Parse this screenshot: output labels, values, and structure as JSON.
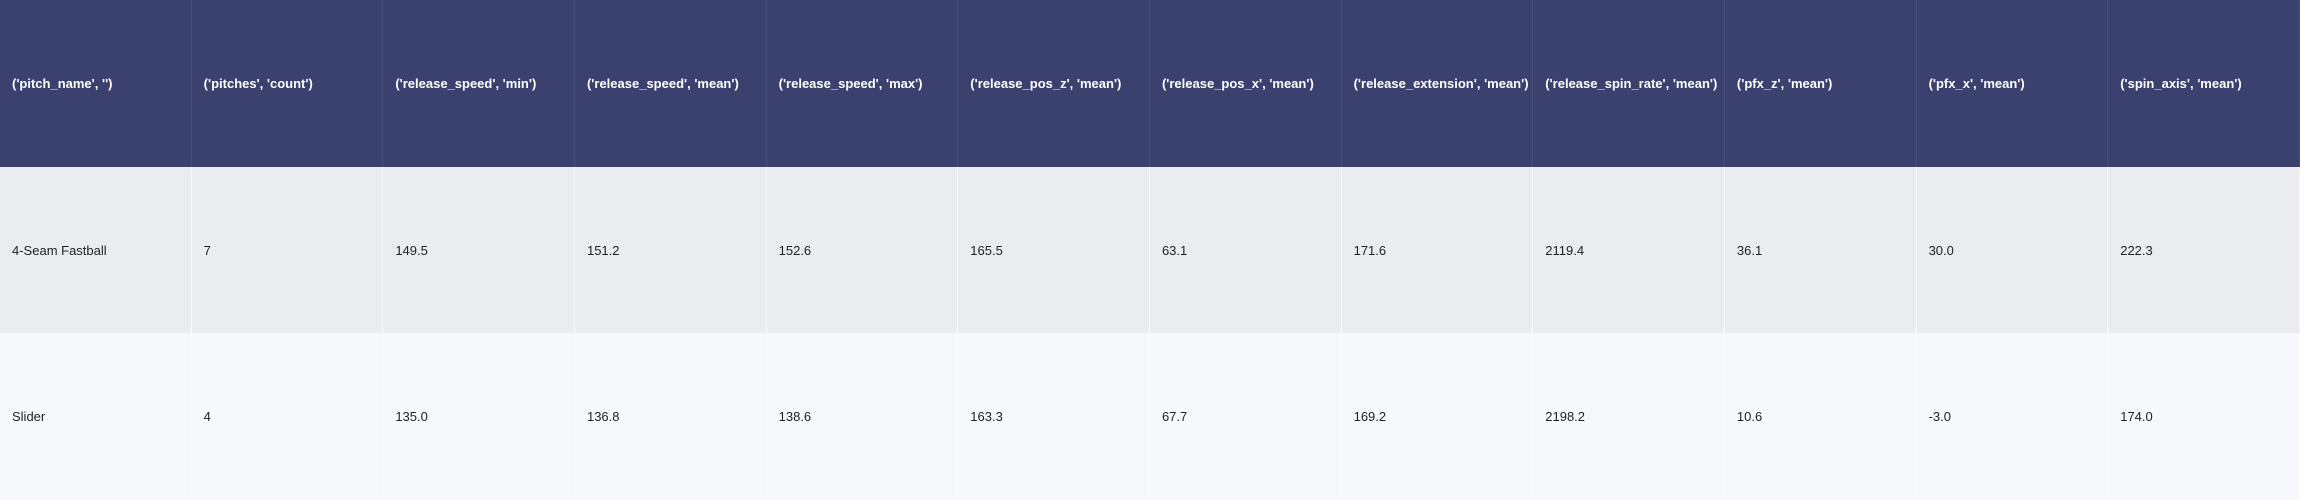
{
  "chart_data": {
    "type": "table",
    "columns": [
      "('pitch_name', '')",
      "('pitches', 'count')",
      "('release_speed', 'min')",
      "('release_speed', 'mean')",
      "('release_speed', 'max')",
      "('release_pos_z', 'mean')",
      "('release_pos_x', 'mean')",
      "('release_extension', 'mean')",
      "('release_spin_rate', 'mean')",
      "('pfx_z', 'mean')",
      "('pfx_x', 'mean')",
      "('spin_axis', 'mean')"
    ],
    "rows": [
      [
        "4-Seam Fastball",
        "7",
        "149.5",
        "151.2",
        "152.6",
        "165.5",
        "63.1",
        "171.6",
        "2119.4",
        "36.1",
        "30.0",
        "222.3"
      ],
      [
        "Slider",
        "4",
        "135.0",
        "136.8",
        "138.6",
        "163.3",
        "67.7",
        "169.2",
        "2198.2",
        "10.6",
        "-3.0",
        "174.0"
      ]
    ]
  },
  "colors": {
    "header_bg": "#3a416f",
    "header_text": "#ffffff",
    "row_odd_bg": "#ebecf0",
    "row_even_bg": "#f7f8fc",
    "body_text": "#222222"
  }
}
